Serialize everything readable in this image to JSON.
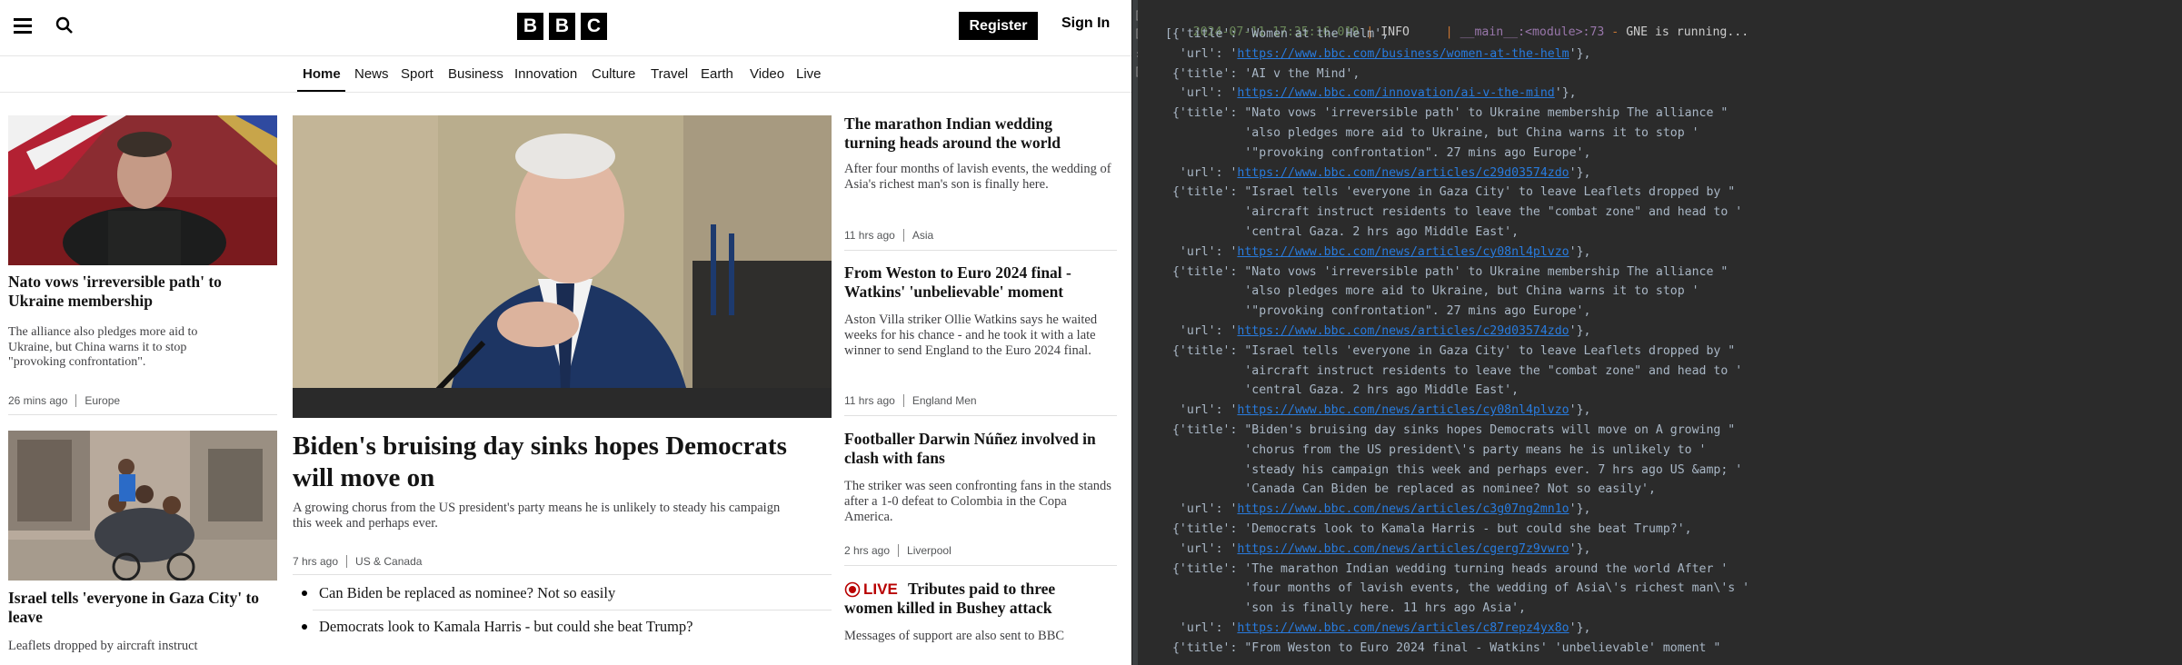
{
  "header": {
    "logo_letters": [
      "B",
      "B",
      "C"
    ],
    "register_label": "Register",
    "signin_label": "Sign In"
  },
  "nav": [
    "Home",
    "News",
    "Sport",
    "Business",
    "Innovation",
    "Culture",
    "Travel",
    "Earth",
    "Video",
    "Live"
  ],
  "stories": {
    "nato": {
      "headline": "Nato vows 'irreversible path' to Ukraine membership",
      "summary": "The alliance also pledges more aid to Ukraine, but China warns it to stop \"provoking confrontation\".",
      "time": "26 mins ago",
      "section": "Europe"
    },
    "israel": {
      "headline": "Israel tells 'everyone in Gaza City' to leave",
      "summary": "Leaflets dropped by aircraft instruct"
    },
    "biden": {
      "headline": "Biden's bruising day sinks hopes Democrats will move on",
      "summary": "A growing chorus from the US president's party means he is unlikely to steady his campaign this week and perhaps ever.",
      "time": "7 hrs ago",
      "section": "US & Canada",
      "related": [
        "Can Biden be replaced as nominee? Not so easily",
        "Democrats look to Kamala Harris - but could she beat Trump?"
      ]
    },
    "wedding": {
      "headline": "The marathon Indian wedding turning heads around the world",
      "summary": "After four months of lavish events, the wedding of Asia's richest man's son is finally here.",
      "time": "11 hrs ago",
      "section": "Asia"
    },
    "watkins": {
      "headline": "From Weston to Euro 2024 final - Watkins' 'unbelievable' moment",
      "summary": "Aston Villa striker Ollie Watkins says he waited weeks for his chance - and he took it with a late winner to send England to the Euro 2024 final.",
      "time": "11 hrs ago",
      "section": "England Men"
    },
    "nunez": {
      "headline": "Footballer Darwin Núñez involved in clash with fans",
      "summary": "The striker was seen confronting fans in the stands after a 1-0 defeat to Colombia in the Copa America.",
      "time": "2 hrs ago",
      "section": "Liverpool"
    },
    "bushey": {
      "live_label": "LIVE",
      "headline": "Tributes paid to three women killed in Bushey attack",
      "summary": "Messages of support are also sent to BBC"
    }
  },
  "terminal": {
    "log": {
      "timestamp": "2024-07-11 17:35:16.019",
      "level": "INFO",
      "module": "__main__:<module>:73",
      "message": "GNE is running..."
    },
    "lines": [
      {
        "pre": "[{'title': 'Women at the Helm',",
        "url": "",
        "post": ""
      },
      {
        "pre": "  'url': '",
        "url": "https://www.bbc.com/business/women-at-the-helm",
        "post": "'},"
      },
      {
        "pre": " {'title': 'AI v the Mind',",
        "url": "",
        "post": ""
      },
      {
        "pre": "  'url': '",
        "url": "https://www.bbc.com/innovation/ai-v-the-mind",
        "post": "'},"
      },
      {
        "pre": " {'title': \"Nato vows 'irreversible path' to Ukraine membership The alliance \"",
        "url": "",
        "post": ""
      },
      {
        "pre": "           'also pledges more aid to Ukraine, but China warns it to stop '",
        "url": "",
        "post": ""
      },
      {
        "pre": "           '\"provoking confrontation\". 27 mins ago Europe',",
        "url": "",
        "post": ""
      },
      {
        "pre": "  'url': '",
        "url": "https://www.bbc.com/news/articles/c29d03574zdo",
        "post": "'},"
      },
      {
        "pre": " {'title': \"Israel tells 'everyone in Gaza City' to leave Leaflets dropped by \"",
        "url": "",
        "post": ""
      },
      {
        "pre": "           'aircraft instruct residents to leave the \"combat zone\" and head to '",
        "url": "",
        "post": ""
      },
      {
        "pre": "           'central Gaza. 2 hrs ago Middle East',",
        "url": "",
        "post": ""
      },
      {
        "pre": "  'url': '",
        "url": "https://www.bbc.com/news/articles/cy08nl4plvzo",
        "post": "'},"
      },
      {
        "pre": " {'title': \"Nato vows 'irreversible path' to Ukraine membership The alliance \"",
        "url": "",
        "post": ""
      },
      {
        "pre": "           'also pledges more aid to Ukraine, but China warns it to stop '",
        "url": "",
        "post": ""
      },
      {
        "pre": "           '\"provoking confrontation\". 27 mins ago Europe',",
        "url": "",
        "post": ""
      },
      {
        "pre": "  'url': '",
        "url": "https://www.bbc.com/news/articles/c29d03574zdo",
        "post": "'},"
      },
      {
        "pre": " {'title': \"Israel tells 'everyone in Gaza City' to leave Leaflets dropped by \"",
        "url": "",
        "post": ""
      },
      {
        "pre": "           'aircraft instruct residents to leave the \"combat zone\" and head to '",
        "url": "",
        "post": ""
      },
      {
        "pre": "           'central Gaza. 2 hrs ago Middle East',",
        "url": "",
        "post": ""
      },
      {
        "pre": "  'url': '",
        "url": "https://www.bbc.com/news/articles/cy08nl4plvzo",
        "post": "'},"
      },
      {
        "pre": " {'title': \"Biden's bruising day sinks hopes Democrats will move on A growing \"",
        "url": "",
        "post": ""
      },
      {
        "pre": "           'chorus from the US president\\'s party means he is unlikely to '",
        "url": "",
        "post": ""
      },
      {
        "pre": "           'steady his campaign this week and perhaps ever. 7 hrs ago US &amp; '",
        "url": "",
        "post": ""
      },
      {
        "pre": "           'Canada Can Biden be replaced as nominee? Not so easily',",
        "url": "",
        "post": ""
      },
      {
        "pre": "  'url': '",
        "url": "https://www.bbc.com/news/articles/c3g07ng2mn1o",
        "post": "'},"
      },
      {
        "pre": " {'title': 'Democrats look to Kamala Harris - but could she beat Trump?',",
        "url": "",
        "post": ""
      },
      {
        "pre": "  'url': '",
        "url": "https://www.bbc.com/news/articles/cgerg7z9vwro",
        "post": "'},"
      },
      {
        "pre": " {'title': 'The marathon Indian wedding turning heads around the world After '",
        "url": "",
        "post": ""
      },
      {
        "pre": "           'four months of lavish events, the wedding of Asia\\'s richest man\\'s '",
        "url": "",
        "post": ""
      },
      {
        "pre": "           'son is finally here. 11 hrs ago Asia',",
        "url": "",
        "post": ""
      },
      {
        "pre": "  'url': '",
        "url": "https://www.bbc.com/news/articles/c87repz4yx8o",
        "post": "'},"
      },
      {
        "pre": " {'title': \"From Weston to Euro 2024 final - Watkins' 'unbelievable' moment \"",
        "url": "",
        "post": ""
      }
    ]
  },
  "colors": {
    "terminal_bg": "#2b2b2b",
    "url": "#287bde",
    "live_red": "#b80000"
  }
}
